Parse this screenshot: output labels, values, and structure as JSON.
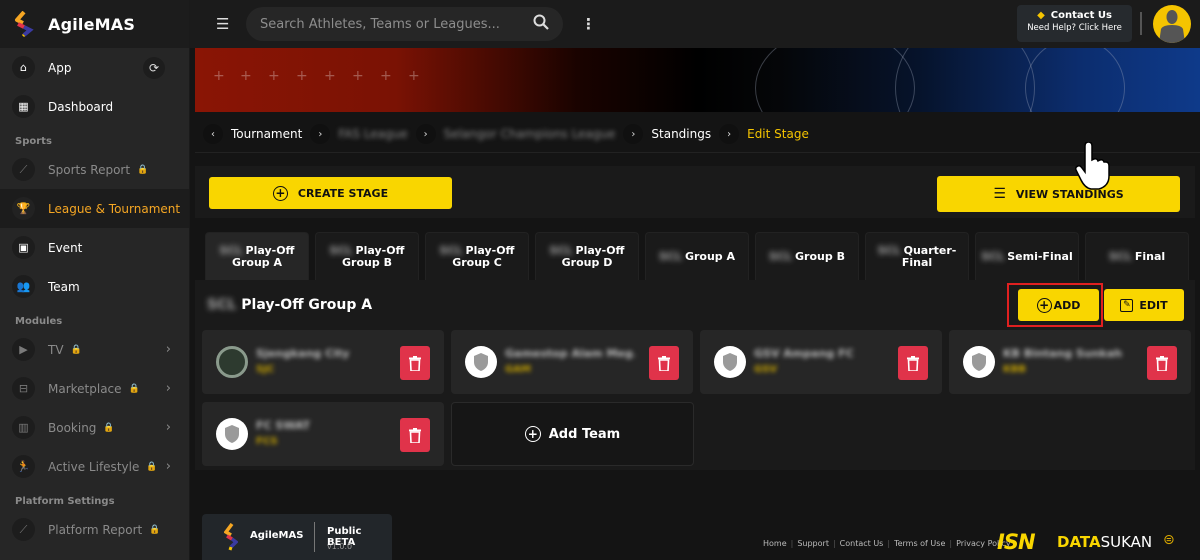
{
  "app": {
    "name": "AgileMAS",
    "brand_colors": {
      "accent": "#f9d600",
      "active_nav": "#f5a623",
      "danger": "#e0334a"
    }
  },
  "sidebar": {
    "top_items": [
      {
        "label": "App",
        "icon": "home-icon",
        "glyph": "⌂",
        "extra": "refresh-icon"
      },
      {
        "label": "Dashboard",
        "icon": "dashboard-icon",
        "glyph": "▦"
      }
    ],
    "sections": [
      {
        "label": "Sports",
        "items": [
          {
            "label": "Sports Report",
            "icon": "trend-icon",
            "glyph": "⟋",
            "locked": true
          },
          {
            "label": "League & Tournament",
            "icon": "trophy-icon",
            "glyph": "🏆",
            "active": true
          },
          {
            "label": "Event",
            "icon": "ticket-icon",
            "glyph": "▣"
          },
          {
            "label": "Team",
            "icon": "team-icon",
            "glyph": "👥"
          }
        ]
      },
      {
        "label": "Modules",
        "items": [
          {
            "label": "TV",
            "icon": "tv-icon",
            "glyph": "▶",
            "locked": true,
            "expandable": true
          },
          {
            "label": "Marketplace",
            "icon": "store-icon",
            "glyph": "⊟",
            "locked": true,
            "expandable": true
          },
          {
            "label": "Booking",
            "icon": "building-icon",
            "glyph": "▥",
            "locked": true,
            "expandable": true
          },
          {
            "label": "Active Lifestyle",
            "icon": "running-icon",
            "glyph": "🏃",
            "locked": true,
            "expandable": true
          }
        ]
      },
      {
        "label": "Platform Settings",
        "items": [
          {
            "label": "Platform Report",
            "icon": "trend-icon",
            "glyph": "⟋",
            "locked": true
          }
        ]
      }
    ]
  },
  "header": {
    "search_placeholder": "Search Athletes, Teams or Leagues...",
    "contact_title": "Contact Us",
    "contact_subtitle": "Need Help? Click Here"
  },
  "breadcrumb": {
    "items": [
      {
        "label": "Tournament",
        "type": "link"
      },
      {
        "label": "FAS League",
        "type": "blurred"
      },
      {
        "label": "Selangor Champions League",
        "type": "blurred"
      },
      {
        "label": "Standings",
        "type": "link"
      },
      {
        "label": "Edit Stage",
        "type": "current"
      }
    ]
  },
  "toolbar": {
    "create_stage_label": "CREATE STAGE",
    "view_standings_label": "VIEW STANDINGS"
  },
  "stage_tabs": [
    {
      "prefix": "SCL",
      "label": "Play-Off Group A",
      "active": true
    },
    {
      "prefix": "SCL",
      "label": "Play-Off Group B"
    },
    {
      "prefix": "SCL",
      "label": "Play-Off Group C"
    },
    {
      "prefix": "SCL",
      "label": "Play-Off Group D"
    },
    {
      "prefix": "SCL",
      "label": "Group A"
    },
    {
      "prefix": "SCL",
      "label": "Group B"
    },
    {
      "prefix": "SCL",
      "label": "Quarter-Final"
    },
    {
      "prefix": "SCL",
      "label": "Semi-Final"
    },
    {
      "prefix": "SCL",
      "label": "Final"
    }
  ],
  "stage": {
    "prefix": "SCL",
    "title": "Play-Off Group A",
    "add_label": "ADD",
    "edit_label": "EDIT",
    "add_team_label": "Add Team",
    "teams": [
      {
        "name": "Sjengkang City",
        "code": "SJC",
        "logo": "club"
      },
      {
        "name": "Gamestop Alam Meg...",
        "code": "GAM",
        "logo": "shield"
      },
      {
        "name": "GSV Ampang FC",
        "code": "GSV",
        "logo": "shield"
      },
      {
        "name": "KB Bintang Sunkah",
        "code": "KBB",
        "logo": "shield"
      },
      {
        "name": "FC SWAT",
        "code": "FCS",
        "logo": "shield"
      }
    ]
  },
  "footer": {
    "brand_name": "AgileMAS",
    "beta_label": "Public BETA",
    "version": "v1.0.0",
    "links": [
      "Home",
      "Support",
      "Contact Us",
      "Terms of Use",
      "Privacy Policy"
    ],
    "partner_logo_text": "ISN",
    "partner_name_highlight": "DATA",
    "partner_name_rest": "SUKAN"
  }
}
